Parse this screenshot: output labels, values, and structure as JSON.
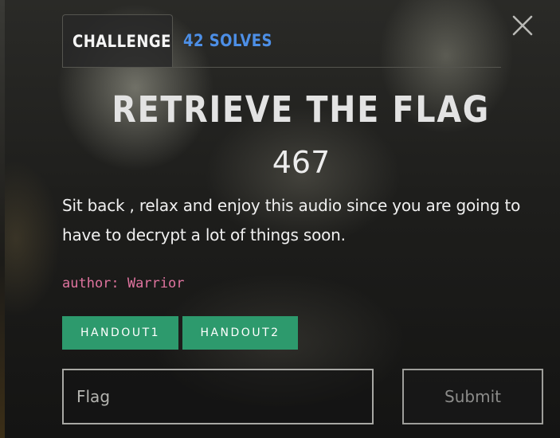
{
  "modal": {
    "close_icon": "close-icon",
    "tabs": [
      {
        "label": "CHALLENGE",
        "active": true
      },
      {
        "label": "42 SOLVES",
        "active": false
      }
    ],
    "challenge": {
      "title": "RETRIEVE THE FLAG",
      "points": "467",
      "description": "Sit back , relax and enjoy this audio since you are going to have to decrypt a lot of things soon.",
      "author": "author: Warrior"
    },
    "handouts": [
      {
        "label": "HANDOUT1"
      },
      {
        "label": "HANDOUT2"
      }
    ],
    "flag_input": {
      "value": "",
      "placeholder": "Flag"
    },
    "submit_label": "Submit"
  },
  "colors": {
    "tab_solves": "#4d8fe6",
    "author": "#e0749f",
    "handout_button": "#2d9a6d",
    "title": "#e3e3e3"
  }
}
